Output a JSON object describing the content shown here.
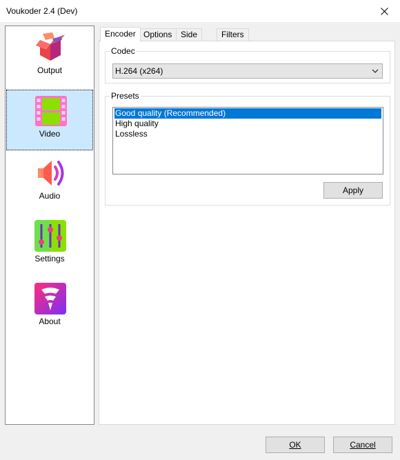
{
  "window": {
    "title": "Voukoder 2.4 (Dev)"
  },
  "sidebar": {
    "items": [
      {
        "label": "Output",
        "icon": "output-box-icon"
      },
      {
        "label": "Video",
        "icon": "video-film-icon",
        "selected": true
      },
      {
        "label": "Audio",
        "icon": "audio-speaker-icon"
      },
      {
        "label": "Settings",
        "icon": "settings-sliders-icon"
      },
      {
        "label": "About",
        "icon": "about-logo-icon"
      }
    ]
  },
  "tabs": [
    {
      "label": "Encoder",
      "active": true
    },
    {
      "label": "Options"
    },
    {
      "label": "Side data"
    },
    {
      "label": "Filters"
    }
  ],
  "codec": {
    "label": "Codec",
    "value": "H.264 (x264)"
  },
  "presets": {
    "label": "Presets",
    "items": [
      {
        "label": "Good quality (Recommended)",
        "selected": true
      },
      {
        "label": "High quality"
      },
      {
        "label": "Lossless"
      }
    ],
    "apply_label": "Apply"
  },
  "footer": {
    "ok_label": "OK",
    "cancel_label": "Cancel"
  },
  "colors": {
    "selection": "#0078d7",
    "nav_selected_bg": "#cce8ff"
  }
}
